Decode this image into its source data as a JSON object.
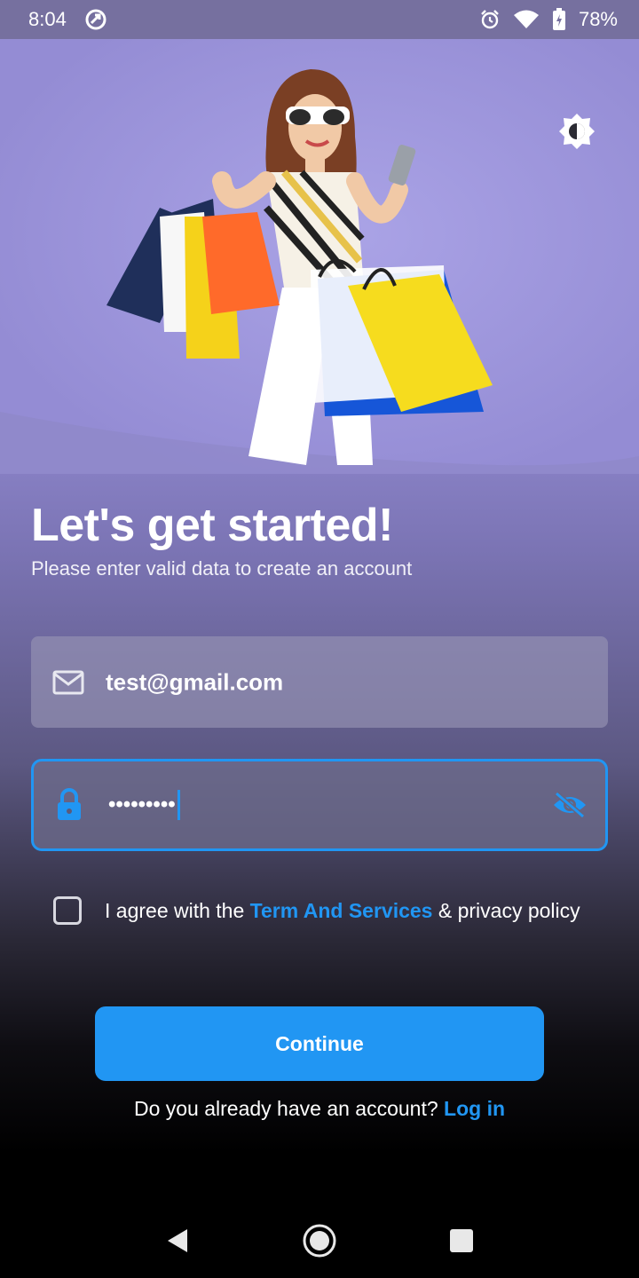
{
  "status_bar": {
    "time": "8:04",
    "battery": "78%",
    "icons": [
      "sync-icon",
      "alarm-icon",
      "wifi-icon",
      "battery-charging-icon"
    ]
  },
  "hero": {
    "image": "woman-with-shopping-bags",
    "theme_toggle_icon": "brightness-icon"
  },
  "heading": {
    "title": "Let's get started!",
    "subtitle": "Please enter valid data to create an account"
  },
  "form": {
    "email": {
      "icon": "mail-icon",
      "value": "test@gmail.com"
    },
    "password": {
      "icon": "lock-icon",
      "value": "•••••••••",
      "toggle_icon": "eye-off-icon"
    },
    "agree": {
      "prefix": "I agree with the ",
      "link": "Term And Services",
      "suffix": " & privacy policy",
      "checked": false
    },
    "continue_label": "Continue"
  },
  "login_prompt": {
    "text": "Do you already have an account? ",
    "link": "Log in"
  },
  "colors": {
    "accent": "#2196f3",
    "hero_bg": "#9b93dc",
    "status_bar": "#76709f"
  },
  "nav_bar": {
    "icons": [
      "back-icon",
      "home-icon",
      "recents-icon"
    ]
  }
}
